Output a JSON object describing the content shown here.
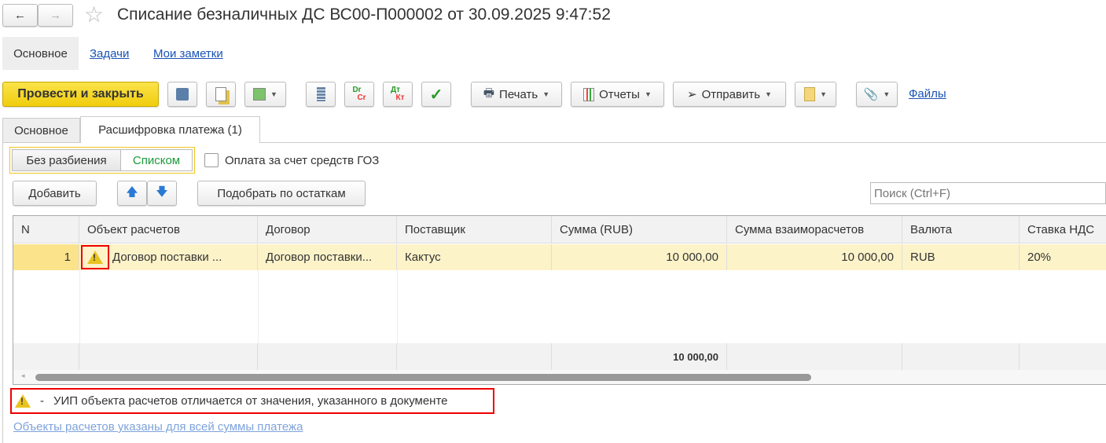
{
  "title": "Списание безналичных ДС ВС00-П000002 от 30.09.2025 9:47:52",
  "nav_tabs": [
    "Основное",
    "Задачи",
    "Мои заметки"
  ],
  "toolbar": {
    "post_close": "Провести и закрыть",
    "print": "Печать",
    "reports": "Отчеты",
    "send": "Отправить",
    "files": "Файлы",
    "dr": "Dr",
    "cr": "Cr",
    "dt": "Дт",
    "kt": "Кт"
  },
  "form_tabs": [
    "Основное",
    "Расшифровка платежа (1)"
  ],
  "mode": {
    "no_split": "Без разбиения",
    "list": "Списком"
  },
  "goz_label": "Оплата за счет средств ГОЗ",
  "actions": {
    "add": "Добавить",
    "pick": "Подобрать по остаткам"
  },
  "search": {
    "placeholder": "Поиск (Ctrl+F)"
  },
  "table": {
    "columns": [
      "N",
      "Объект расчетов",
      "Договор",
      "Поставщик",
      "Сумма (RUB)",
      "Сумма взаиморасчетов",
      "Валюта",
      "Ставка НДС"
    ],
    "rows": [
      {
        "n": "1",
        "object": "Договор поставки ...",
        "contract": "Договор поставки...",
        "supplier": "Кактус",
        "sum": "10 000,00",
        "sum_settle": "10 000,00",
        "currency": "RUB",
        "vat": "20%"
      }
    ],
    "total_sum": "10 000,00"
  },
  "legend": {
    "dash": "-",
    "text": "УИП объекта расчетов отличается от значения, указанного в документе"
  },
  "bottom_link": "Объекты расчетов указаны для всей суммы платежа"
}
